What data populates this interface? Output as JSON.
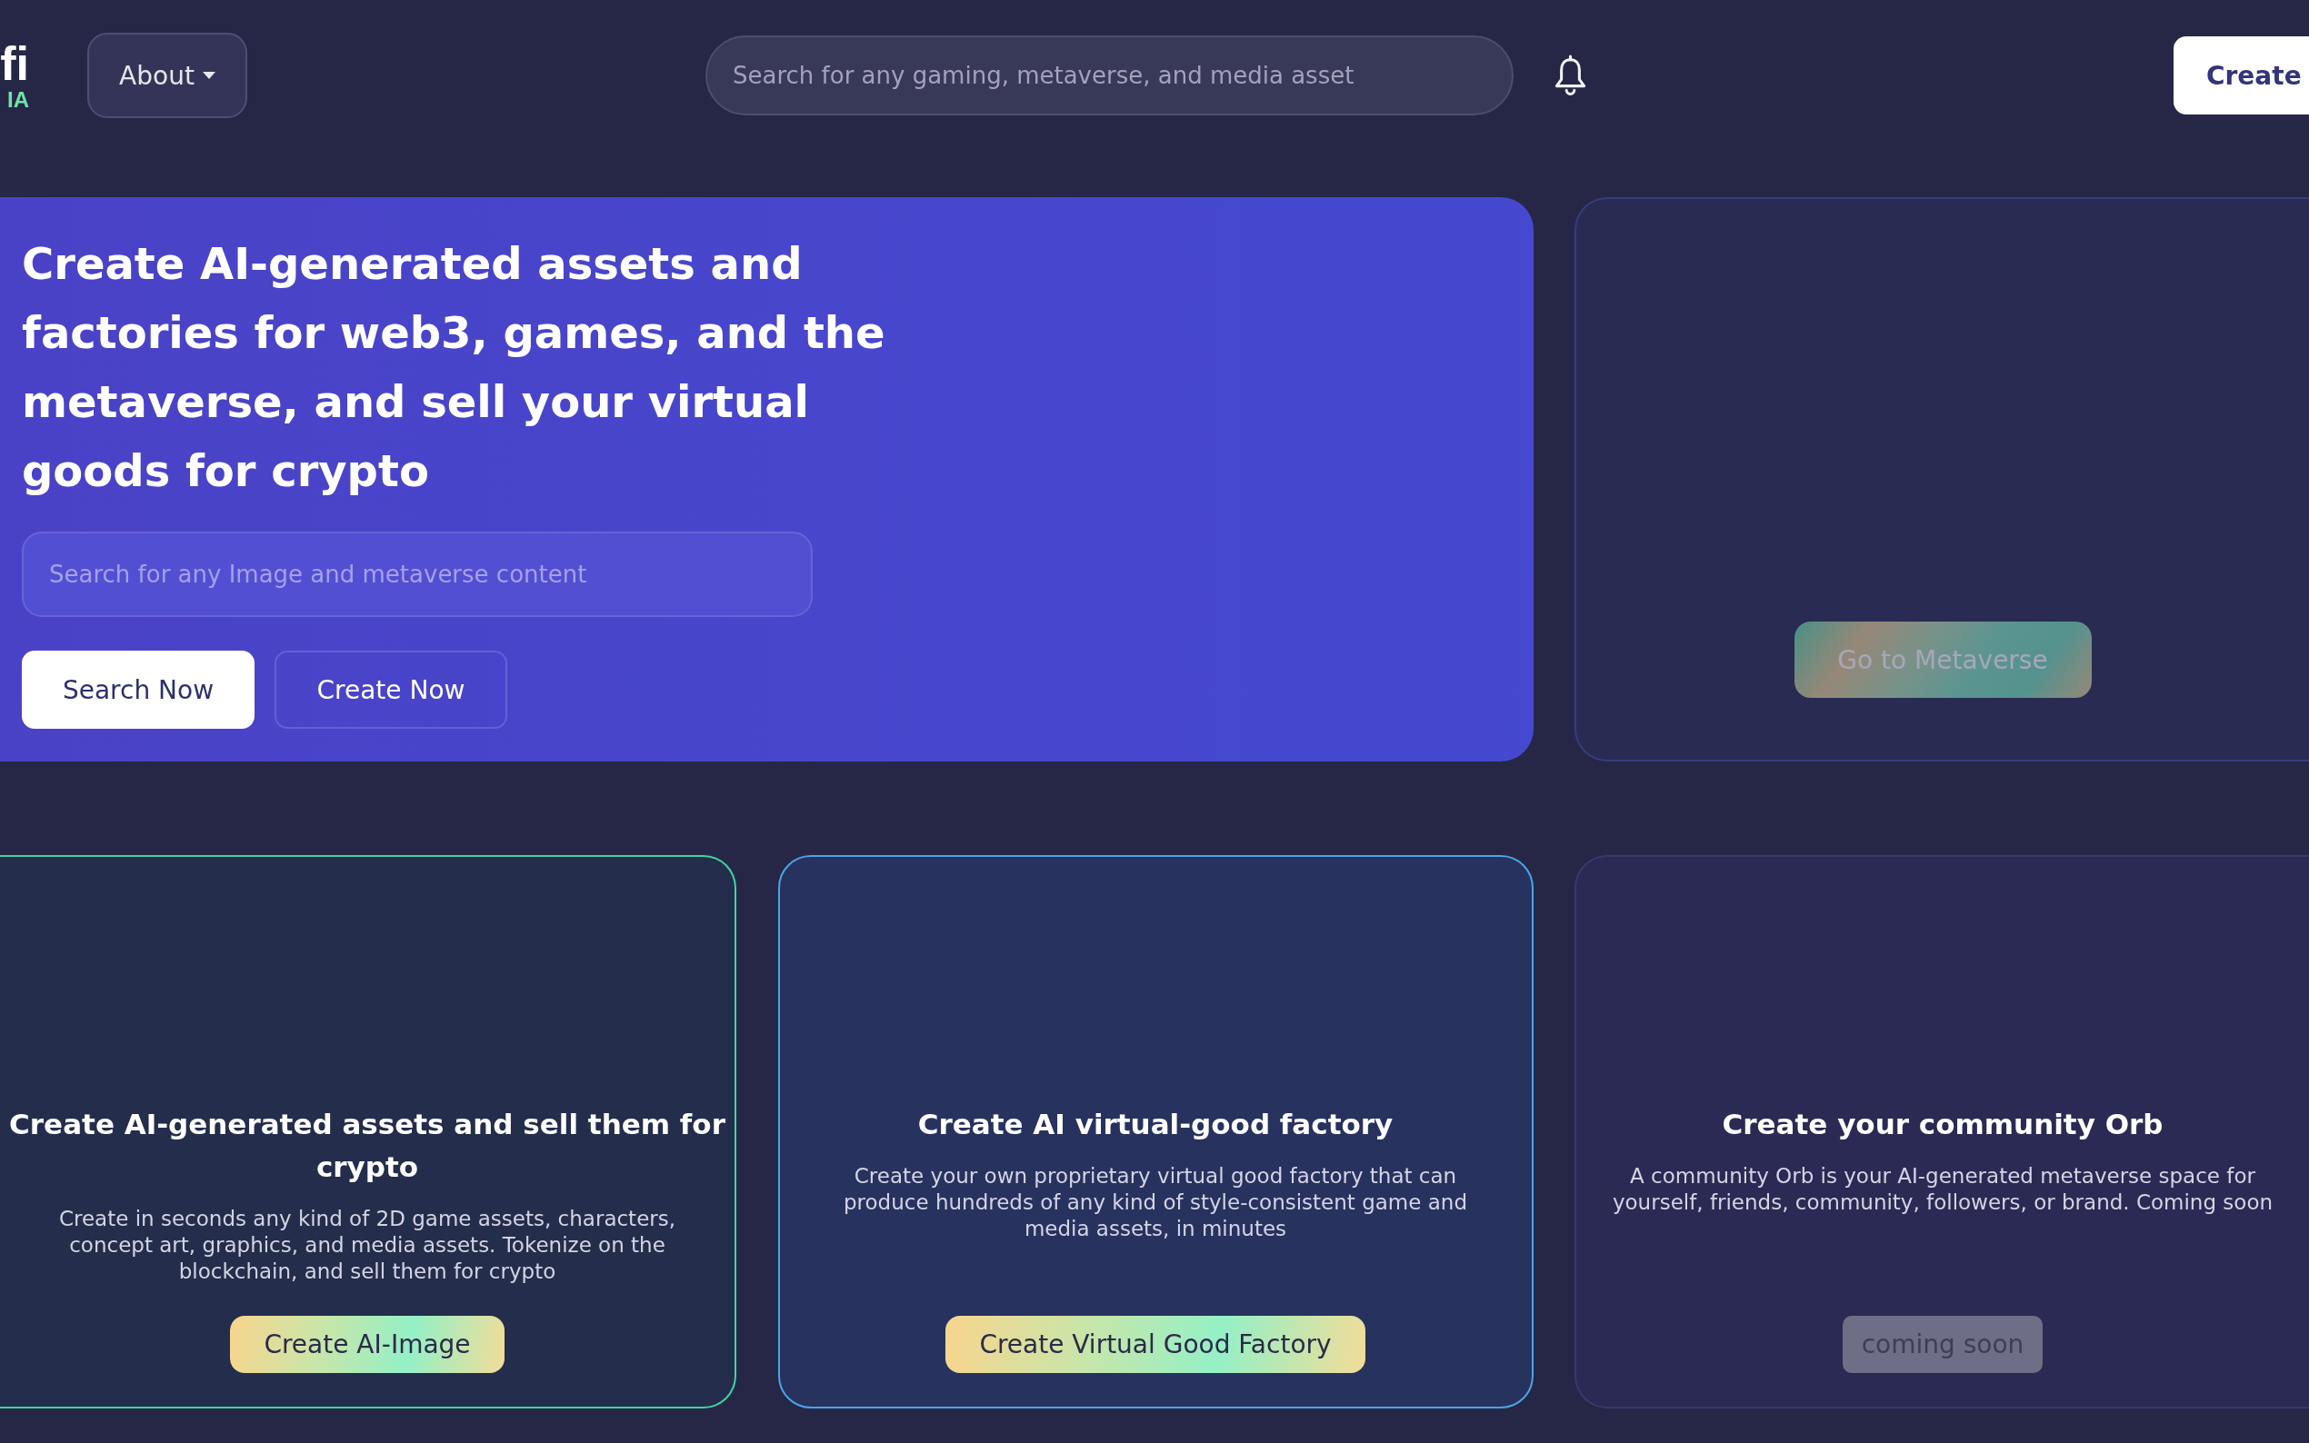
{
  "header": {
    "logo": {
      "wordmark": "fi",
      "tagline": "IA"
    },
    "about_menu": {
      "label": "About"
    },
    "search": {
      "placeholder": "Search for any gaming, metaverse, and media asset"
    },
    "create_button": {
      "label": "Create"
    }
  },
  "hero": {
    "heading": "Create AI-generated assets and factories for web3, games, and the metaverse, and sell your virtual goods for crypto",
    "search": {
      "placeholder": "Search for any Image and metaverse content"
    },
    "buttons": [
      {
        "label": "Search Now",
        "kind": "primary"
      },
      {
        "label": "Create Now",
        "kind": "outline"
      }
    ]
  },
  "metaverse_card": {
    "button": {
      "label": "Go to Metaverse",
      "disabled": true
    }
  },
  "feature_cards": [
    {
      "title": "Create AI-generated assets and sell them for crypto",
      "description": "Create in seconds any kind of 2D game assets, characters, concept art, graphics, and media assets. Tokenize on the blockchain, and sell them for crypto",
      "button": {
        "label": "Create AI-Image",
        "disabled": false
      }
    },
    {
      "title": "Create AI virtual-good factory",
      "description": "Create your own proprietary virtual good factory that can produce hundreds of any kind of style-consistent game and media assets, in minutes",
      "button": {
        "label": "Create Virtual Good Factory",
        "disabled": false
      }
    },
    {
      "title": "Create your community Orb",
      "description": "A community Orb is your AI-generated metaverse space for yourself, friends, community, followers, or brand. Coming soon",
      "button": {
        "label": "coming soon",
        "disabled": true
      }
    }
  ]
}
